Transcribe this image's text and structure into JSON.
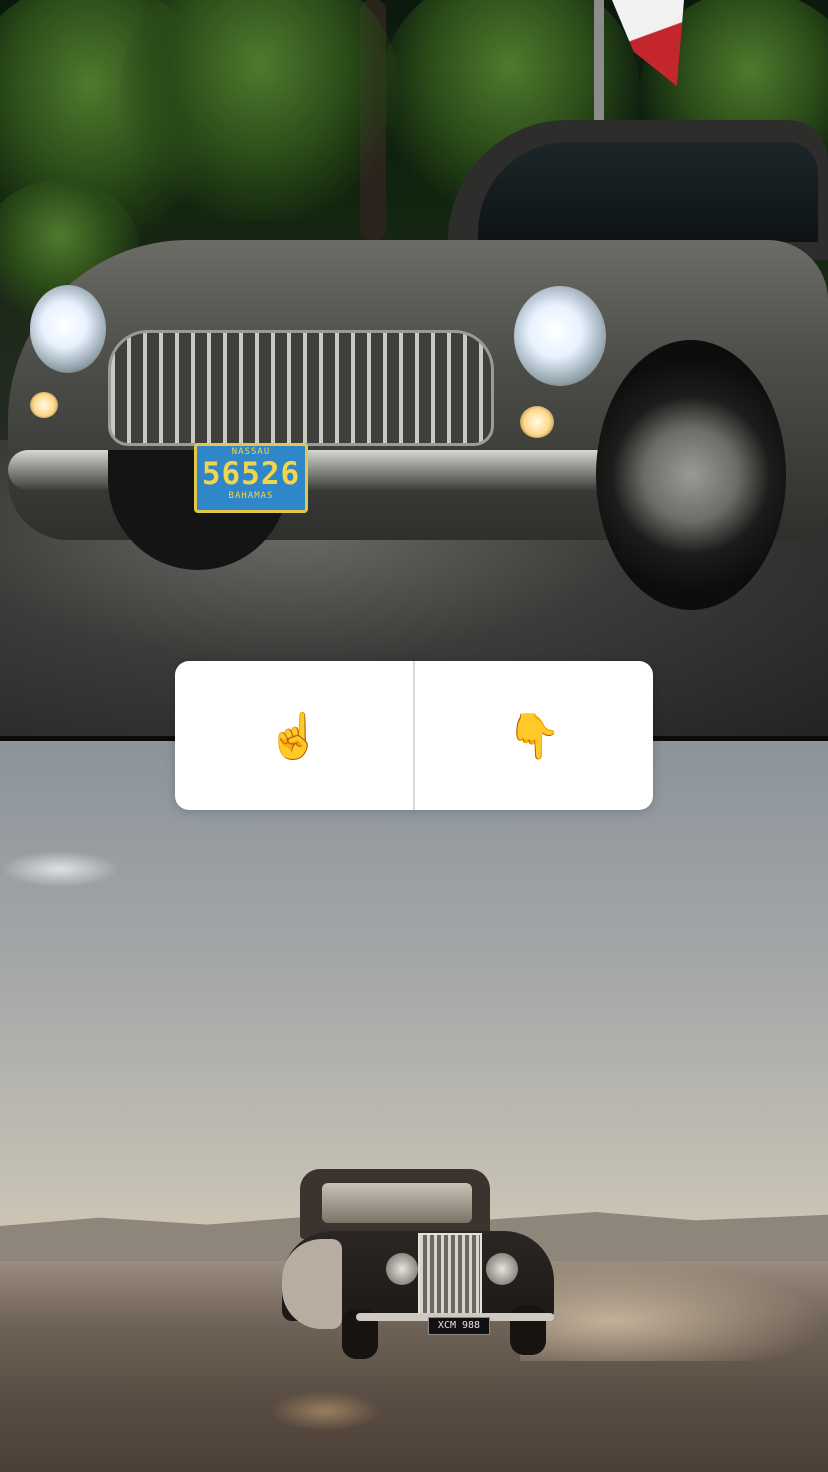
{
  "story": {
    "top_photo": {
      "plate": {
        "top_text": "NASSAU",
        "number": "56526",
        "bottom_text": "BAHAMAS"
      }
    },
    "bottom_photo": {
      "plate": {
        "number": "XCM 988"
      }
    }
  },
  "poll": {
    "options": [
      {
        "icon": "pointing-up-icon",
        "emoji": "☝️"
      },
      {
        "icon": "pointing-down-icon",
        "emoji": "👇"
      }
    ]
  },
  "colors": {
    "poll_background": "#ffffff",
    "poll_divider": "#d8d8d8",
    "plate_blue": "#2f86c8",
    "plate_yellow": "#f2d54a"
  }
}
